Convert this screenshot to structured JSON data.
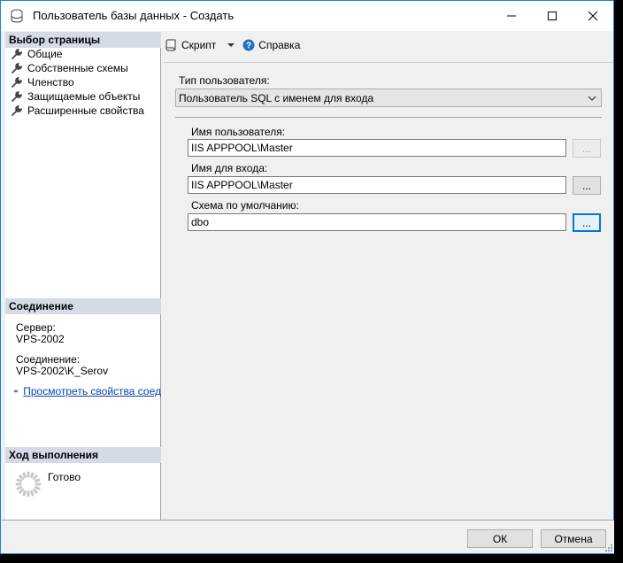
{
  "window": {
    "title": "Пользователь базы данных - Создать"
  },
  "left": {
    "select_page_header": "Выбор страницы",
    "pages": [
      {
        "label": "Общие"
      },
      {
        "label": "Собственные схемы"
      },
      {
        "label": "Членство"
      },
      {
        "label": "Защищаемые объекты"
      },
      {
        "label": "Расширенные свойства"
      }
    ],
    "connection_header": "Соединение",
    "server_label": "Сервер:",
    "server_value": "VPS-2002",
    "connection_label": "Соединение:",
    "connection_value": "VPS-2002\\K_Serov",
    "view_props_link": "Просмотреть свойства соед",
    "progress_header": "Ход выполнения",
    "progress_status": "Готово"
  },
  "toolbar": {
    "script_label": "Скрипт",
    "help_label": "Справка"
  },
  "form": {
    "user_type_label": "Тип пользователя:",
    "user_type_value": "Пользователь SQL с именем для входа",
    "username_label": "Имя пользователя:",
    "username_value": "IIS APPPOOL\\Master",
    "login_label": "Имя для входа:",
    "login_value": "IIS APPPOOL\\Master",
    "schema_label": "Схема по умолчанию:",
    "schema_value": "dbo",
    "browse_label": "..."
  },
  "buttons": {
    "ok": "ОК",
    "cancel": "Отмена"
  },
  "colors": {
    "accent": "#0078d7",
    "section_header_bg": "#d4dbe6",
    "link": "#0645ad",
    "window_border": "#1883d7"
  },
  "icons": {
    "title": "database-icon",
    "page": "wrench-icon",
    "script": "script-icon",
    "dropdown": "chevron-down-icon",
    "help": "help-icon",
    "connection": "plug-icon",
    "progress": "spinner-icon"
  }
}
